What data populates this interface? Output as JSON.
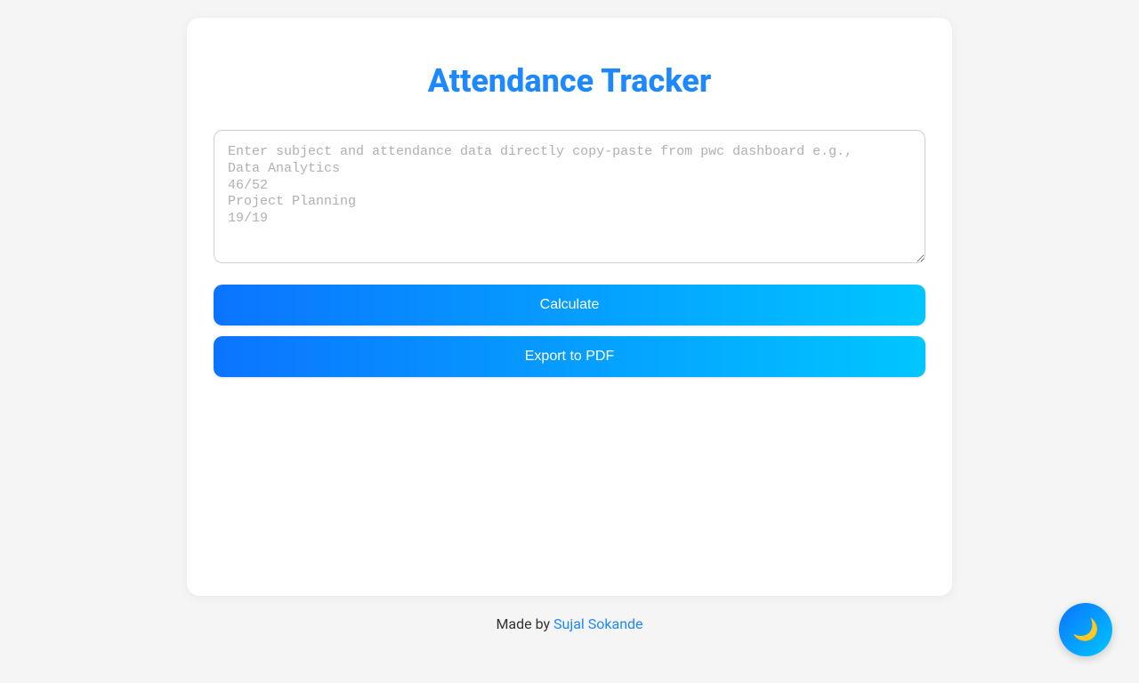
{
  "header": {
    "title": "Attendance Tracker"
  },
  "input": {
    "placeholder": "Enter subject and attendance data directly copy-paste from pwc dashboard e.g.,\nData Analytics\n46/52\nProject Planning\n19/19",
    "value": ""
  },
  "buttons": {
    "calculate": "Calculate",
    "export": "Export to PDF"
  },
  "footer": {
    "prefix": "Made by ",
    "author": "Sujal Sokande"
  },
  "theme_toggle": {
    "icon": "🌙"
  }
}
